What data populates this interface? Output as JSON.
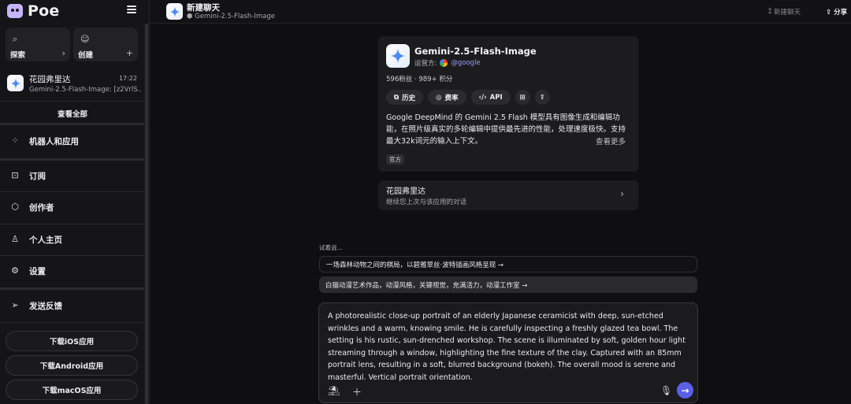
{
  "sidebar": {
    "logo": "Poe",
    "quick_actions": [
      {
        "label": "探索",
        "icon": "search-icon",
        "action_glyph": "›"
      },
      {
        "label": "创建",
        "icon": "create-bot-icon",
        "action_glyph": "+"
      }
    ],
    "recent_chat": {
      "title": "花园弗里达",
      "time": "17:22",
      "preview": "Gemini-2.5-Flash-Image: [z2VrlS..."
    },
    "see_all": "查看全部",
    "nav": [
      {
        "label": "机器人和应用",
        "icon": "apps-icon"
      },
      {
        "label": "订阅",
        "icon": "subscription-icon"
      },
      {
        "label": "创作者",
        "icon": "creator-icon"
      },
      {
        "label": "个人主页",
        "icon": "profile-icon"
      },
      {
        "label": "设置",
        "icon": "settings-icon"
      },
      {
        "label": "发送反馈",
        "icon": "send-feedback-icon"
      }
    ],
    "downloads": [
      "下载iOS应用",
      "下载Android应用",
      "下载macOS应用"
    ]
  },
  "header": {
    "title": "新建聊天",
    "subtitle": "Gemini-2.5-Flash-Image",
    "new_chat": "新建聊天",
    "share": "分享"
  },
  "bot": {
    "name": "Gemini-2.5-Flash-Image",
    "operator_label": "运营方:",
    "operator_handle": "@google",
    "stats": "596粉丝 · 989+ 积分",
    "actions": [
      "历史",
      "费率",
      "API"
    ],
    "description": "Google DeepMind 的 Gemini 2.5 Flash 模型具有图像生成和编辑功能，在照片级真实的多轮编辑中提供最先进的性能，处理速度极快。支持最大32k词元的输入上下文。",
    "see_more": "查看更多",
    "tag": "官方"
  },
  "continue": {
    "title": "花园弗里达",
    "subtitle": "继续您上次与该应用的对话"
  },
  "suggestions": {
    "label": "试着说...",
    "items": [
      "一场森林动物之间的棋局，以碧雅翠丝·波特插画风格呈现 →",
      "白猫动漫艺术作品，动漫风格，关键视觉，充满活力，动漫工作室 →"
    ]
  },
  "composer": {
    "text": "A photorealistic close-up portrait of an elderly Japanese ceramicist with deep, sun-etched wrinkles and a warm, knowing smile. He is carefully inspecting a freshly glazed tea bowl. The setting is his rustic, sun-drenched workshop. The scene is illuminated by soft, golden hour light streaming through a window, highlighting the fine texture of the clay. Captured with an 85mm portrait lens, resulting in a soft, blurred background (bokeh). The overall mood is serene and masterful. Vertical portrait orientation."
  },
  "colors": {
    "accent": "#5b5fe8",
    "handle": "#9a9cf6",
    "background": "#0e0e10"
  }
}
